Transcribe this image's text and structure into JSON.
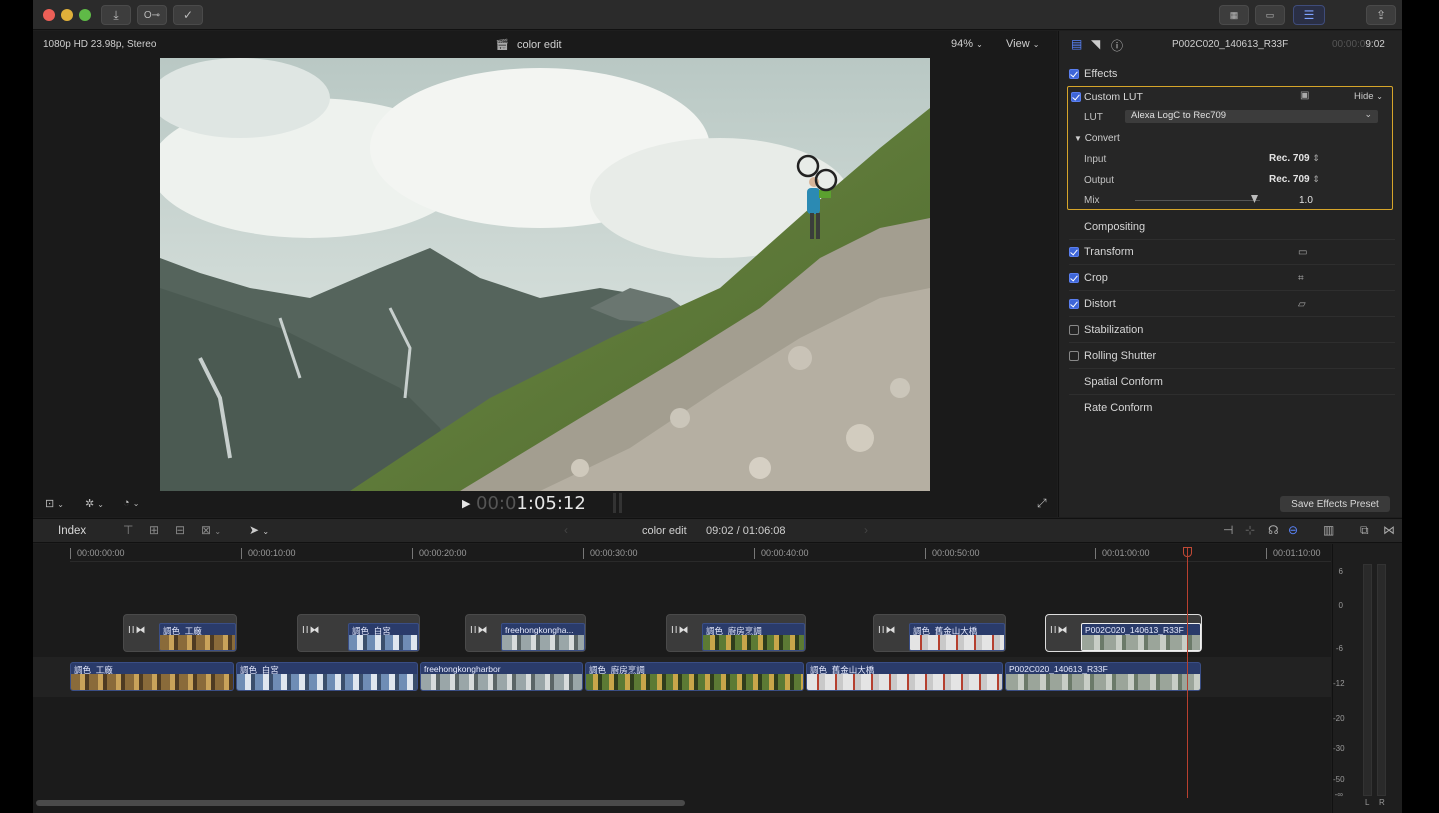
{
  "colors": {
    "accent_blue": "#3e66d8",
    "lut_highlight": "#d6a52a",
    "playhead": "#b8402f",
    "clip_blue": "#2a3b6a"
  },
  "titlebar": {
    "traffic_lights": [
      "close",
      "minimize",
      "zoom"
    ],
    "left_buttons": [
      "import-icon",
      "key-icon",
      "checkmark-icon"
    ],
    "right_buttons": [
      "browser-grid-icon",
      "timeline-filmstrip-icon",
      "inspector-sliders-icon",
      "share-icon"
    ]
  },
  "viewer": {
    "format_info": "1080p HD 23.98p, Stereo",
    "project_title": "color edit",
    "zoom": "94%",
    "view_menu": "View",
    "timecode_dim": "00:0",
    "timecode_main": "1:05:12",
    "play_icon": "▶"
  },
  "inspector": {
    "clip_name": "P002C020_140613_R33F",
    "time_dim": "00:00:0",
    "time_main": "9:02",
    "sections": {
      "effects": "Effects",
      "custom_lut": "Custom LUT",
      "hide": "Hide",
      "lut_label": "LUT",
      "lut_value": "Alexa LogC to Rec709",
      "convert": "Convert",
      "input_label": "Input",
      "input_value": "Rec. 709",
      "output_label": "Output",
      "output_value": "Rec. 709",
      "mix_label": "Mix",
      "mix_value": "1.0",
      "compositing": "Compositing",
      "transform": "Transform",
      "crop": "Crop",
      "distort": "Distort",
      "stabilization": "Stabilization",
      "rolling_shutter": "Rolling Shutter",
      "spatial_conform": "Spatial Conform",
      "rate_conform": "Rate Conform"
    },
    "save_preset": "Save Effects Preset"
  },
  "timeline_bar": {
    "index": "Index",
    "project": "color edit",
    "position": "09:02 / 01:06:08"
  },
  "ruler": [
    "00:00:00:00",
    "00:00:10:00",
    "00:00:20:00",
    "00:00:30:00",
    "00:00:40:00",
    "00:00:50:00",
    "00:01:00:00",
    "00:01:10:00"
  ],
  "connected_clips": [
    {
      "label": "調色_工廠"
    },
    {
      "label": "調色_白宮"
    },
    {
      "label": "freehongkongha..."
    },
    {
      "label": "調色_廚房烹調"
    },
    {
      "label": "調色_舊金山大橋"
    },
    {
      "label": "P002C020_140613_R33F"
    }
  ],
  "primary_clips": [
    {
      "label": "調色_工廠"
    },
    {
      "label": "調色_白宮"
    },
    {
      "label": "freehongkongharbor"
    },
    {
      "label": "調色_廚房烹調"
    },
    {
      "label": "調色_舊金山大橋"
    },
    {
      "label": "P002C020_140613_R33F"
    }
  ],
  "audio_meter_scale": [
    "6",
    "0",
    "-6",
    "-12",
    "-20",
    "-30",
    "-50",
    "-∞"
  ],
  "audio_channels": [
    "L",
    "R"
  ]
}
